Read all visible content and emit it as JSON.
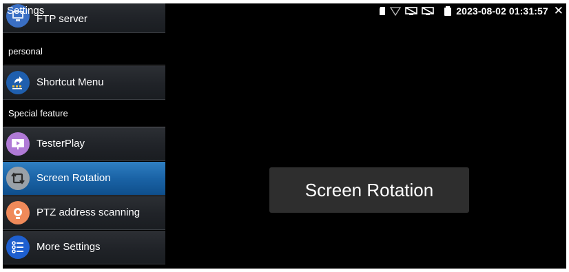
{
  "status_bar": {
    "title": "Settings",
    "datetime": "2023-08-02 01:31:57",
    "close_icon": "close-icon"
  },
  "sidebar": {
    "items": [
      {
        "label": "FTP server",
        "icon": "ftp-server-icon",
        "color": "#3a6fc4"
      },
      {
        "section": "personal"
      },
      {
        "label": "Shortcut Menu",
        "icon": "shortcut-menu-icon",
        "color": "#1f5fae"
      },
      {
        "section": "Special feature"
      },
      {
        "label": "TesterPlay",
        "icon": "testerplay-icon",
        "color": "#b07ad6"
      },
      {
        "label": "Screen Rotation",
        "icon": "screen-rotation-icon",
        "color": "#9aa1a8",
        "selected": true
      },
      {
        "label": "PTZ address scanning",
        "icon": "ptz-camera-icon",
        "color": "#f08a5a"
      },
      {
        "label": "More Settings",
        "icon": "more-settings-icon",
        "color": "#1e5fcf"
      }
    ]
  },
  "toast": {
    "message": "Screen Rotation"
  },
  "colors": {
    "selected_item": "#1a63a6",
    "background": "#000000",
    "toast_bg": "#2e2e2e"
  }
}
